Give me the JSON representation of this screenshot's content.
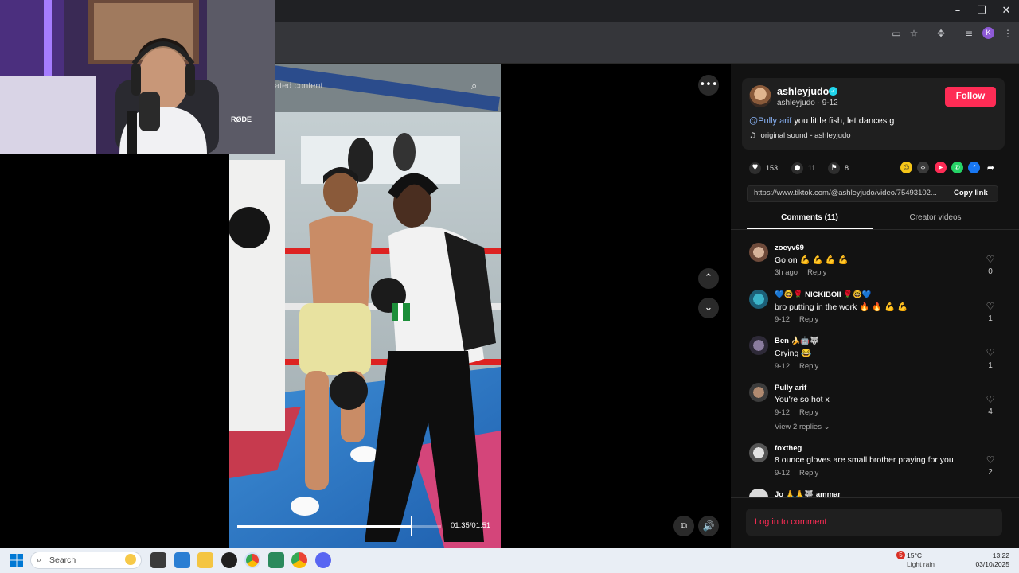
{
  "browser": {
    "window_controls": {
      "minimize": "–",
      "maximize": "❐",
      "close": "✕"
    },
    "profile_initial": "K"
  },
  "video": {
    "related_label": "ated content",
    "current_time": "01:35",
    "duration": "01:51",
    "time_display": "01:35/01:51",
    "progress": 0.855
  },
  "post": {
    "author": "ashleyjudo",
    "author_sub": "ashleyjudo · 9-12",
    "follow_label": "Follow",
    "caption_mention": "@Pully arif",
    "caption_text": " you little fish, let dances g",
    "sound": "original sound - ashleyjudo",
    "likes": "153",
    "comments": "11",
    "saves": "8",
    "url": "https://www.tiktok.com/@ashleyjudo/video/75493102...",
    "copy_link_label": "Copy link"
  },
  "tabs": {
    "comments": "Comments (11)",
    "creator": "Creator videos"
  },
  "comments": [
    {
      "user": "zoeyv69",
      "text": "Go on 💪 💪 💪 💪",
      "date": "3h ago",
      "reply": "Reply",
      "likes": "0"
    },
    {
      "user": "💙🤓🌹 NICKIBOII 🌹🤓💙",
      "text": "bro putting in the work 🔥 🔥 💪 💪",
      "date": "9-12",
      "reply": "Reply",
      "likes": "1"
    },
    {
      "user": "Ben 🍌🤖🐺",
      "text": "Crying 😂",
      "date": "9-12",
      "reply": "Reply",
      "likes": "1"
    },
    {
      "user": "Pully arif",
      "text": "You're so hot x",
      "date": "9-12",
      "reply": "Reply",
      "likes": "4",
      "view_replies": "View 2 replies ⌄"
    },
    {
      "user": "foxtheg",
      "text": "8 ounce gloves are small brother praying for you",
      "date": "9-12",
      "reply": "Reply",
      "likes": "2"
    },
    {
      "user": "Jo 🙏🙏🐺 ammar",
      "text": "",
      "date": "",
      "reply": "",
      "likes": ""
    }
  ],
  "login_label": "Log in to comment",
  "taskbar": {
    "search_placeholder": "Search",
    "weather_badge": "5",
    "weather_temp": "15°C",
    "weather_desc": "Light rain",
    "time": "13:22",
    "date": "03/10/2025"
  },
  "colors": {
    "accent": "#fe2c55",
    "verified": "#20d5ec",
    "mention": "#8ab4f8"
  }
}
